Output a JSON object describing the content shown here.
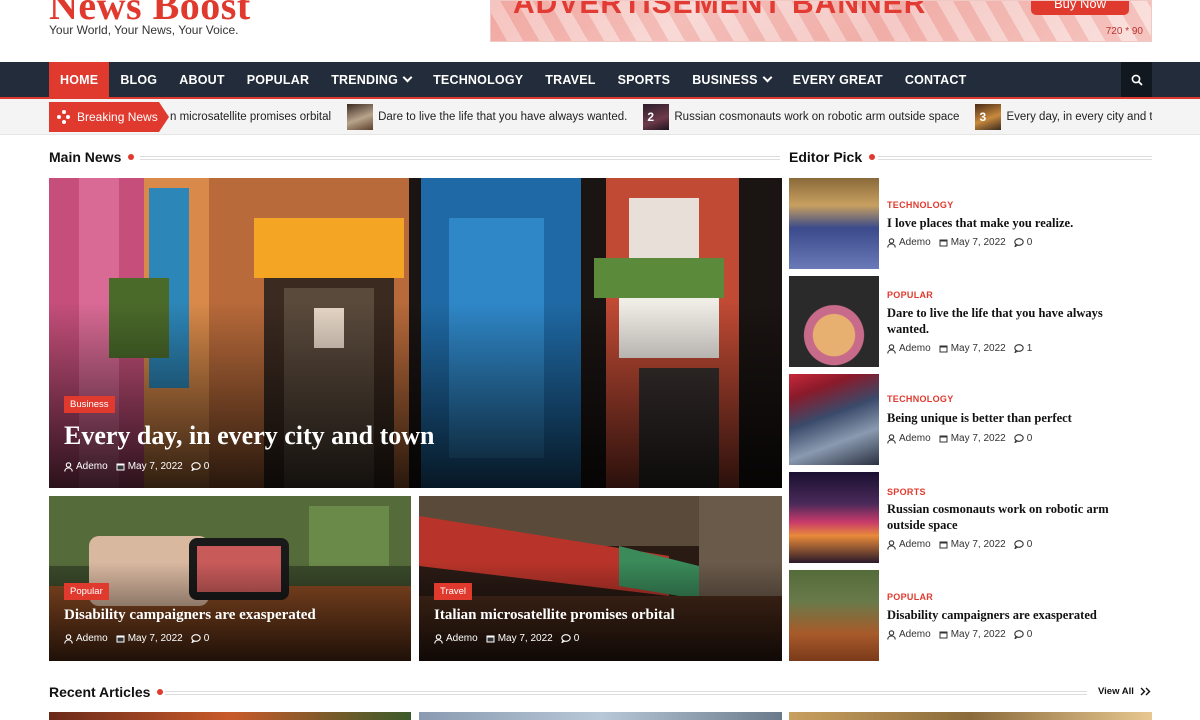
{
  "site": {
    "name": "News Boost",
    "tagline": "Your World, Your News, Your Voice."
  },
  "ad": {
    "headline": "ADVERTISEMENT BANNER",
    "button": "Buy Now",
    "size": "720 * 90"
  },
  "nav": {
    "items": [
      "HOME",
      "BLOG",
      "ABOUT",
      "POPULAR",
      "TRENDING",
      "TECHNOLOGY",
      "TRAVEL",
      "SPORTS",
      "BUSINESS",
      "EVERY GREAT",
      "CONTACT"
    ],
    "active": "HOME"
  },
  "ticker": {
    "label": "Breaking News",
    "items": [
      {
        "num": "",
        "text": "n microsatellite promises orbital"
      },
      {
        "num": "",
        "text": "Dare to live the life that you have always wanted."
      },
      {
        "num": "2",
        "text": "Russian cosmonauts work on robotic arm outside space"
      },
      {
        "num": "3",
        "text": "Every day, in every city and town"
      },
      {
        "num": "4",
        "text": ""
      }
    ]
  },
  "main_news": {
    "heading": "Main News",
    "featured": {
      "badge": "Business",
      "title": "Every day, in every city and town",
      "author": "Ademo",
      "date": "May 7, 2022",
      "comments": "0"
    },
    "cards": [
      {
        "badge": "Popular",
        "title": "Disability campaigners are exasperated",
        "author": "Ademo",
        "date": "May 7, 2022",
        "comments": "0"
      },
      {
        "badge": "Travel",
        "title": "Italian microsatellite promises orbital",
        "author": "Ademo",
        "date": "May 7, 2022",
        "comments": "0"
      }
    ]
  },
  "editor_pick": {
    "heading": "Editor Pick",
    "items": [
      {
        "category": "TECHNOLOGY",
        "title": "I love places that make you realize.",
        "author": "Ademo",
        "date": "May 7, 2022",
        "comments": "0"
      },
      {
        "category": "POPULAR",
        "title": "Dare to live the life that you have always wanted.",
        "author": "Ademo",
        "date": "May 7, 2022",
        "comments": "1"
      },
      {
        "category": "TECHNOLOGY",
        "title": "Being unique is better than perfect",
        "author": "Ademo",
        "date": "May 7, 2022",
        "comments": "0"
      },
      {
        "category": "SPORTS",
        "title": "Russian cosmonauts work on robotic arm outside space",
        "author": "Ademo",
        "date": "May 7, 2022",
        "comments": "0"
      },
      {
        "category": "POPULAR",
        "title": "Disability campaigners are exasperated",
        "author": "Ademo",
        "date": "May 7, 2022",
        "comments": "0"
      }
    ]
  },
  "recent": {
    "heading": "Recent Articles",
    "view_all": "View All"
  },
  "colors": {
    "accent": "#e03a2f",
    "nav_bg": "#222c3a"
  }
}
